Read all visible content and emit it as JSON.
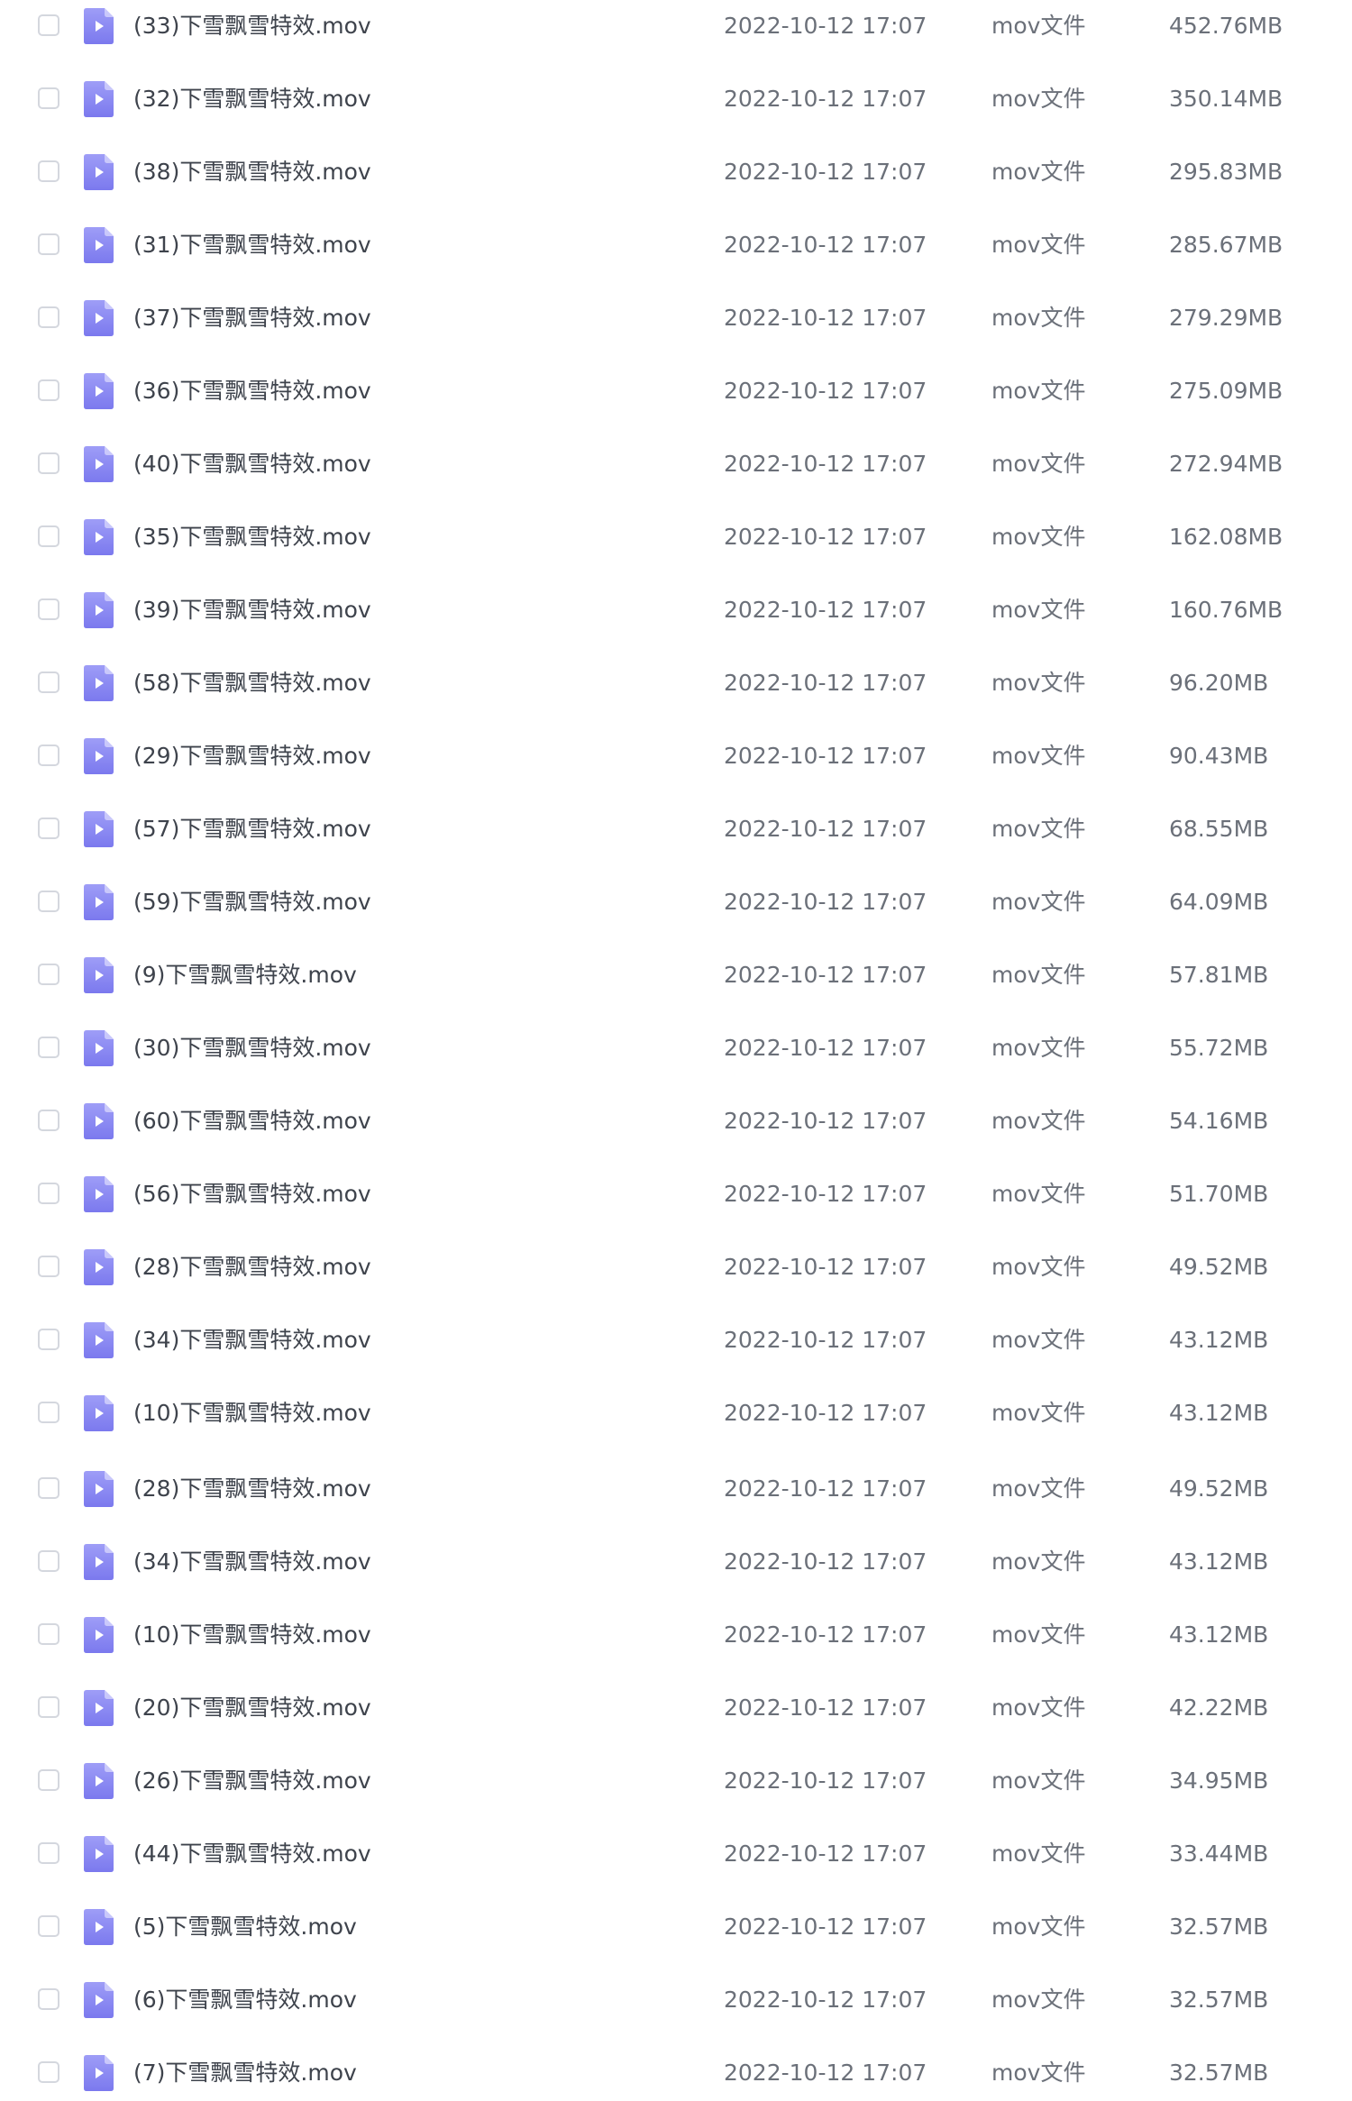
{
  "files": [
    {
      "name": "(33)下雪飘雪特效.mov",
      "modified": "2022-10-12 17:07",
      "type": "mov文件",
      "size": "452.76MB"
    },
    {
      "name": "(32)下雪飘雪特效.mov",
      "modified": "2022-10-12 17:07",
      "type": "mov文件",
      "size": "350.14MB"
    },
    {
      "name": "(38)下雪飘雪特效.mov",
      "modified": "2022-10-12 17:07",
      "type": "mov文件",
      "size": "295.83MB"
    },
    {
      "name": "(31)下雪飘雪特效.mov",
      "modified": "2022-10-12 17:07",
      "type": "mov文件",
      "size": "285.67MB"
    },
    {
      "name": "(37)下雪飘雪特效.mov",
      "modified": "2022-10-12 17:07",
      "type": "mov文件",
      "size": "279.29MB"
    },
    {
      "name": "(36)下雪飘雪特效.mov",
      "modified": "2022-10-12 17:07",
      "type": "mov文件",
      "size": "275.09MB"
    },
    {
      "name": "(40)下雪飘雪特效.mov",
      "modified": "2022-10-12 17:07",
      "type": "mov文件",
      "size": "272.94MB"
    },
    {
      "name": "(35)下雪飘雪特效.mov",
      "modified": "2022-10-12 17:07",
      "type": "mov文件",
      "size": "162.08MB"
    },
    {
      "name": "(39)下雪飘雪特效.mov",
      "modified": "2022-10-12 17:07",
      "type": "mov文件",
      "size": "160.76MB"
    },
    {
      "name": "(58)下雪飘雪特效.mov",
      "modified": "2022-10-12 17:07",
      "type": "mov文件",
      "size": "96.20MB"
    },
    {
      "name": "(29)下雪飘雪特效.mov",
      "modified": "2022-10-12 17:07",
      "type": "mov文件",
      "size": "90.43MB"
    },
    {
      "name": "(57)下雪飘雪特效.mov",
      "modified": "2022-10-12 17:07",
      "type": "mov文件",
      "size": "68.55MB"
    },
    {
      "name": "(59)下雪飘雪特效.mov",
      "modified": "2022-10-12 17:07",
      "type": "mov文件",
      "size": "64.09MB"
    },
    {
      "name": "(9)下雪飘雪特效.mov",
      "modified": "2022-10-12 17:07",
      "type": "mov文件",
      "size": "57.81MB"
    },
    {
      "name": "(30)下雪飘雪特效.mov",
      "modified": "2022-10-12 17:07",
      "type": "mov文件",
      "size": "55.72MB"
    },
    {
      "name": "(60)下雪飘雪特效.mov",
      "modified": "2022-10-12 17:07",
      "type": "mov文件",
      "size": "54.16MB"
    },
    {
      "name": "(56)下雪飘雪特效.mov",
      "modified": "2022-10-12 17:07",
      "type": "mov文件",
      "size": "51.70MB"
    },
    {
      "name": "(28)下雪飘雪特效.mov",
      "modified": "2022-10-12 17:07",
      "type": "mov文件",
      "size": "49.52MB"
    },
    {
      "name": "(34)下雪飘雪特效.mov",
      "modified": "2022-10-12 17:07",
      "type": "mov文件",
      "size": "43.12MB"
    },
    {
      "name": "(10)下雪飘雪特效.mov",
      "modified": "2022-10-12 17:07",
      "type": "mov文件",
      "size": "43.12MB"
    },
    {
      "name": "(28)下雪飘雪特效.mov",
      "modified": "2022-10-12 17:07",
      "type": "mov文件",
      "size": "49.52MB"
    },
    {
      "name": "(34)下雪飘雪特效.mov",
      "modified": "2022-10-12 17:07",
      "type": "mov文件",
      "size": "43.12MB"
    },
    {
      "name": "(10)下雪飘雪特效.mov",
      "modified": "2022-10-12 17:07",
      "type": "mov文件",
      "size": "43.12MB"
    },
    {
      "name": "(20)下雪飘雪特效.mov",
      "modified": "2022-10-12 17:07",
      "type": "mov文件",
      "size": "42.22MB"
    },
    {
      "name": "(26)下雪飘雪特效.mov",
      "modified": "2022-10-12 17:07",
      "type": "mov文件",
      "size": "34.95MB"
    },
    {
      "name": "(44)下雪飘雪特效.mov",
      "modified": "2022-10-12 17:07",
      "type": "mov文件",
      "size": "33.44MB"
    },
    {
      "name": "(5)下雪飘雪特效.mov",
      "modified": "2022-10-12 17:07",
      "type": "mov文件",
      "size": "32.57MB"
    },
    {
      "name": "(6)下雪飘雪特效.mov",
      "modified": "2022-10-12 17:07",
      "type": "mov文件",
      "size": "32.57MB"
    },
    {
      "name": "(7)下雪飘雪特效.mov",
      "modified": "2022-10-12 17:07",
      "type": "mov文件",
      "size": "32.57MB"
    }
  ],
  "colors": {
    "icon_top": "#9e9df7",
    "icon_bottom": "#7b79ee",
    "icon_fold": "#c9c8fb",
    "checkbox_border": "#d4d7de",
    "name_text": "#3e434c",
    "meta_text": "#6b7079"
  },
  "icons": {
    "file_type": "video-file-icon",
    "select": "checkbox"
  }
}
